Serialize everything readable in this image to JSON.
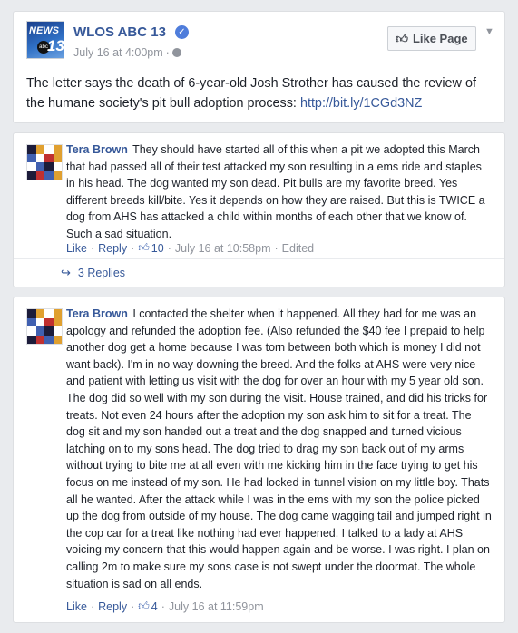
{
  "post": {
    "page_name": "WLOS ABC 13",
    "date": "July 16 at 4:00pm",
    "privacy_icon": "globe-icon",
    "like_page_label": "Like Page",
    "text": "The letter says the death of 6-year-old Josh Strother has caused the review of the humane society's pit bull adoption process: ",
    "link": "http://bit.ly/1CGd3NZ",
    "avatar": {
      "news": "NEWS",
      "abc": "abc",
      "num": "13"
    }
  },
  "comments": [
    {
      "author": "Tera Brown",
      "text": "They should have started all of this when a pit we adopted this March that had passed all of their test attacked my son resulting in a ems ride and staples in his head. The dog wanted my son dead. Pit bulls are my favorite breed. Yes different breeds kill/bite. Yes it depends on how they are raised. But this is TWICE a dog from AHS has attacked a child within months of each other that we know of. Such a sad situation.",
      "like_label": "Like",
      "reply_label": "Reply",
      "like_count": "10",
      "timestamp": "July 16 at 10:58pm",
      "edited": "Edited",
      "replies_label": "3 Replies"
    },
    {
      "author": "Tera Brown",
      "text": "I contacted the shelter when it happened. All they had for me was an apology and refunded the adoption fee. (Also refunded the $40 fee I prepaid to help another dog get a home because I was torn between both which is money I did not want back). I'm in no way downing the breed. And the folks at AHS were very nice and patient with letting us visit with the dog for over an hour with my 5 year old son. The dog did so well with my son during the visit. House trained, and did his tricks for treats. Not even 24 hours after the adoption my son ask him to sit for a treat. The dog sit and my son handed out a treat and the dog snapped and turned vicious latching on to my sons head. The dog tried to drag my son back out of my arms without trying to bite me at all even with me kicking him in the face trying to get his focus on me instead of my son. He had locked in tunnel vision on my little boy. Thats all he wanted. After the attack while I was in the ems with my son the police picked up the dog from outside of my house. The dog came wagging tail and jumped right in the cop car for a treat like nothing had ever happened. I talked to a lady at AHS voicing my concern that this would happen again and be worse. I was right. I plan on calling 2m to make sure my sons case is not swept under the doormat. The whole situation is sad on all ends.",
      "like_label": "Like",
      "reply_label": "Reply",
      "like_count": "4",
      "timestamp": "July 16 at 11:59pm"
    }
  ],
  "colors": {
    "link_blue": "#365899",
    "meta_gray": "#90949c",
    "background": "#e9ebee"
  }
}
